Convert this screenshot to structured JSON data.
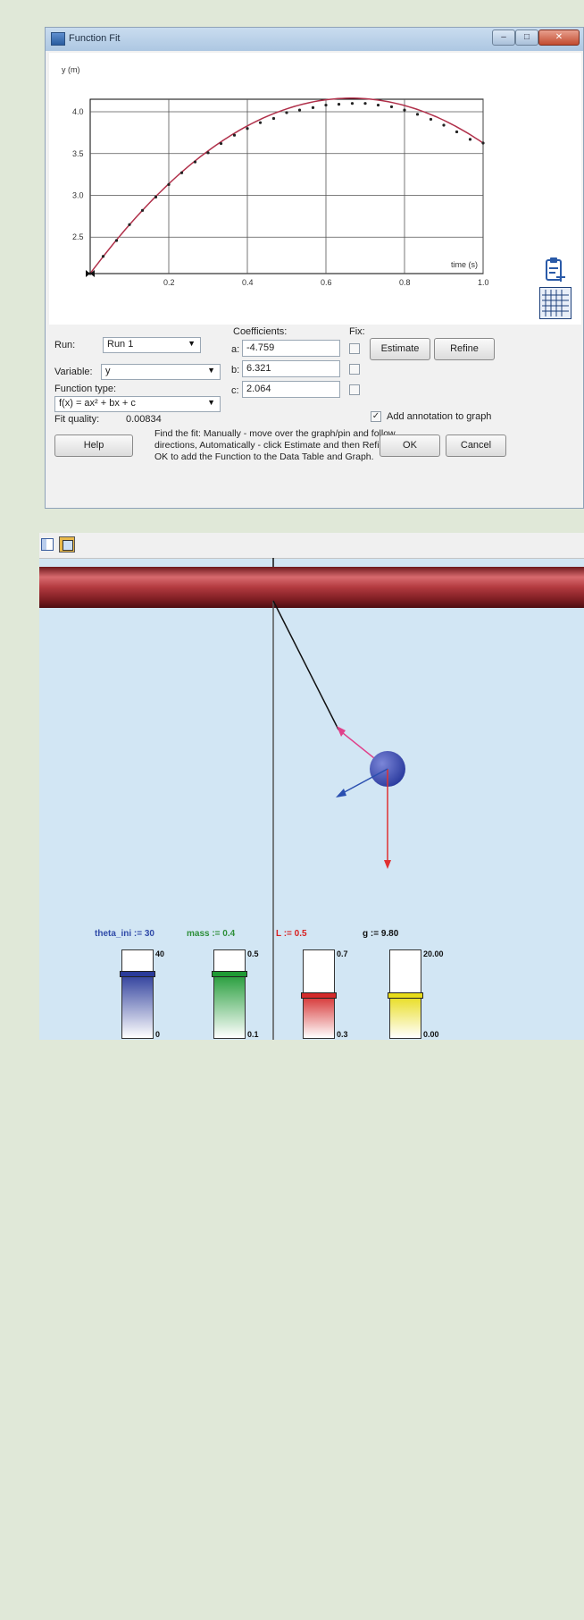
{
  "window": {
    "title": "Function Fit",
    "buttons": {
      "minimize": "–",
      "maximize": "□",
      "close": "✕"
    }
  },
  "graph": {
    "ylabel": "y (m)",
    "xlabel": "time (s)",
    "x_ticks": [
      "0.2",
      "0.4",
      "0.6",
      "0.8",
      "1.0"
    ],
    "y_ticks": [
      "2.5",
      "3.0",
      "3.5",
      "4.0"
    ],
    "xlim": [
      0,
      1.0
    ],
    "ylim": [
      2.064,
      4.15
    ],
    "fit": {
      "a": -4.759,
      "b": 6.321,
      "c": 2.064
    },
    "curve_color": "#b0304a",
    "icons": [
      "clipboard-add-icon",
      "data-table-icon"
    ]
  },
  "chart_data": {
    "type": "scatter",
    "xlabel": "time (s)",
    "ylabel": "y (m)",
    "x": [
      0.0,
      0.033,
      0.067,
      0.1,
      0.133,
      0.167,
      0.2,
      0.233,
      0.267,
      0.3,
      0.333,
      0.367,
      0.4,
      0.433,
      0.467,
      0.5,
      0.533,
      0.567,
      0.6,
      0.633,
      0.667,
      0.7,
      0.733,
      0.767,
      0.8,
      0.833,
      0.867,
      0.9,
      0.933,
      0.967,
      1.0
    ],
    "y": [
      2.064,
      2.27,
      2.46,
      2.65,
      2.82,
      2.98,
      3.13,
      3.27,
      3.4,
      3.51,
      3.62,
      3.72,
      3.8,
      3.87,
      3.92,
      3.99,
      4.02,
      4.05,
      4.08,
      4.09,
      4.1,
      4.1,
      4.08,
      4.06,
      4.02,
      3.97,
      3.91,
      3.84,
      3.76,
      3.67,
      3.626
    ],
    "xlim": [
      0,
      1.0
    ],
    "ylim": [
      2.064,
      4.15
    ],
    "grid": true
  },
  "form": {
    "run_label": "Run:",
    "run_value": "Run 1",
    "variable_label": "Variable:",
    "variable_value": "y",
    "function_type_label": "Function type:",
    "function_type_value": "f(x) = ax² + bx + c",
    "coefficients_label": "Coefficients:",
    "fix_label": "Fix:",
    "coef_a_label": "a:",
    "coef_a": "-4.759",
    "coef_b_label": "b:",
    "coef_b": "6.321",
    "coef_c_label": "c:",
    "coef_c": "2.064",
    "estimate": "Estimate",
    "refine": "Refine",
    "fit_quality_label": "Fit quality:",
    "fit_quality": "0.00834",
    "annotation_check": "✓",
    "annotation_label": "Add annotation to graph",
    "help": "Help",
    "hint": "Find the fit: Manually - move over the graph/pin and follow directions, Automatically - click Estimate and then Refine. Click OK to add the Function to the Data Table and Graph.",
    "ok": "OK",
    "cancel": "Cancel"
  },
  "simulation": {
    "sliders": [
      {
        "label": "theta_ini := 30",
        "max": "40",
        "min": "0",
        "value": 30,
        "range": [
          0,
          40
        ],
        "color": "#2a3b9a",
        "label_color": "#2f4aa8"
      },
      {
        "label": "mass := 0.4",
        "max": "0.5",
        "min": "0.1",
        "value": 0.4,
        "range": [
          0.1,
          0.5
        ],
        "color": "#1f9a35",
        "label_color": "#2e8f3a"
      },
      {
        "label": "L := 0.5",
        "max": "0.7",
        "min": "0.3",
        "value": 0.5,
        "range": [
          0.3,
          0.7
        ],
        "color": "#d42a2a",
        "label_color": "#d82020"
      },
      {
        "label": "g := 9.80",
        "max": "20.00",
        "min": "0.00",
        "value": 9.8,
        "range": [
          0,
          20
        ],
        "color": "#e8dc1a",
        "label_color": "#111111"
      }
    ]
  }
}
